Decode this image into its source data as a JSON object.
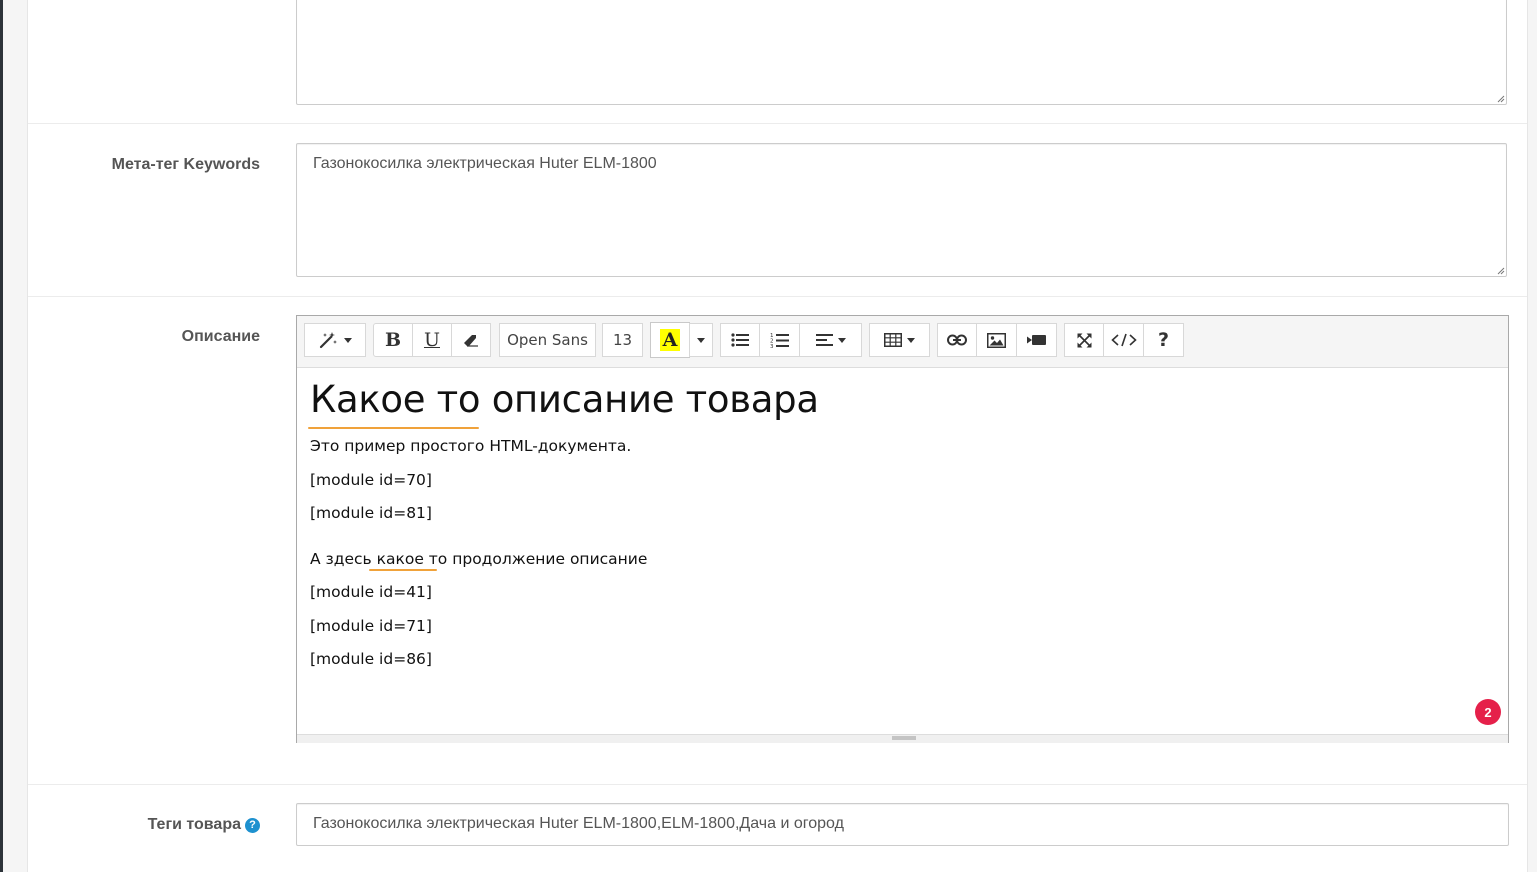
{
  "form": {
    "keywords_label": "Мета-тег Keywords",
    "keywords_value": "Газонокосилка электрическая Huter ELM-1800",
    "description_label": "Описание",
    "tags_label": "Теги товара",
    "tags_value": "Газонокосилка электрическая Huter ELM-1800,ELM-1800,Дача и огород"
  },
  "toolbar": {
    "font_name": "Open Sans",
    "font_size": "13",
    "color_letter": "A",
    "highlight_color": "#ffff00"
  },
  "editor": {
    "heading": "Какое то описание товара",
    "paragraphs": [
      "Это пример простого HTML-документа.",
      "[module id=70]",
      "[module id=81]",
      "А здесь какое то продолжение описание",
      "[module id=41]",
      "[module id=71]",
      "[module id=86]"
    ],
    "badge_count": "2"
  },
  "colors": {
    "accent": "#1e91cf",
    "badge": "#e5204a",
    "spellcheck": "#f0a23a"
  }
}
